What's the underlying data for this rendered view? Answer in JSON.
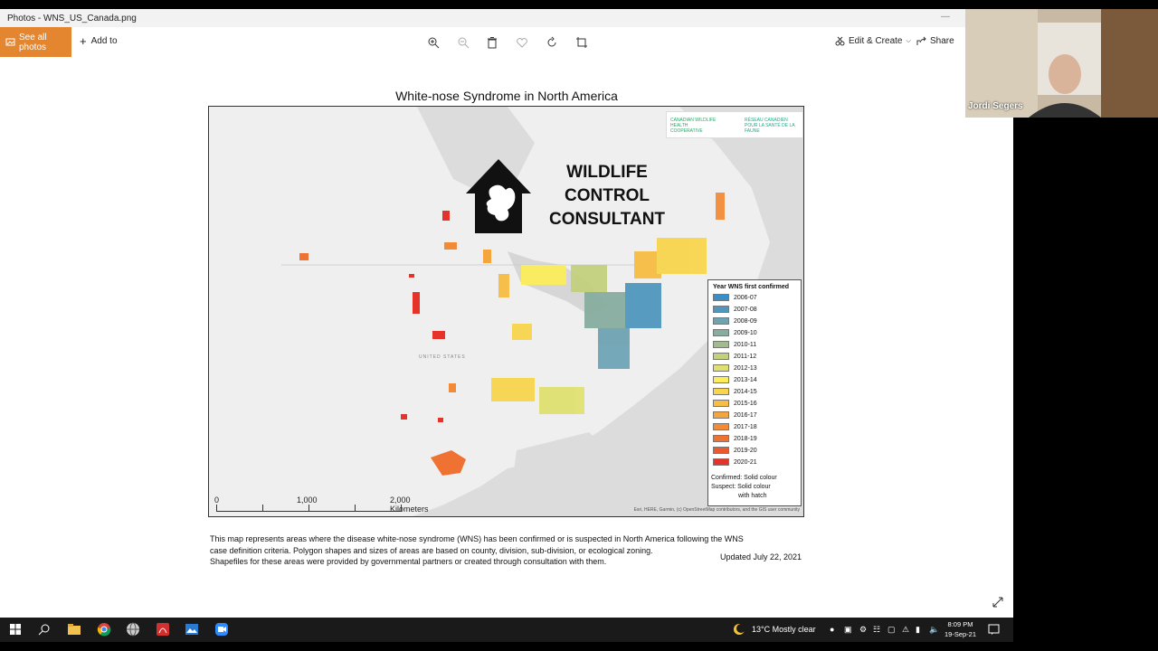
{
  "window": {
    "title": "Photos - WNS_US_Canada.png"
  },
  "toolbar": {
    "see_all_label": "See all photos",
    "add_to_label": "Add to",
    "edit_label": "Edit & Create",
    "share_label": "Share"
  },
  "map": {
    "title": "White-nose Syndrome in North America",
    "watermark": "WILDLIFE CONTROL CONSULTANT",
    "partner_logo_left": "CANADIAN WILDLIFE HEALTH COOPERATIVE",
    "partner_logo_right": "RÉSEAU CANADIEN POUR LA SANTÉ DE LA FAUNE",
    "country_label": "UNITED STATES",
    "scale": {
      "zero": "0",
      "mid": "1,000",
      "end": "2,000 Kilometers"
    },
    "attribution": "Esri, HERE, Garmin, (c) OpenStreetMap contributors, and the GIS user community",
    "legend": {
      "title": "Year WNS first confirmed",
      "items": [
        {
          "label": "2006-07",
          "color": "#3a8fc8"
        },
        {
          "label": "2007-08",
          "color": "#4f97bf"
        },
        {
          "label": "2008-09",
          "color": "#6ea3b4"
        },
        {
          "label": "2009-10",
          "color": "#87ad9f"
        },
        {
          "label": "2010-11",
          "color": "#a2bb8e"
        },
        {
          "label": "2011-12",
          "color": "#c3d07e"
        },
        {
          "label": "2012-13",
          "color": "#dfe070"
        },
        {
          "label": "2013-14",
          "color": "#fbee5a"
        },
        {
          "label": "2014-15",
          "color": "#f9d54d"
        },
        {
          "label": "2015-16",
          "color": "#f7bd44"
        },
        {
          "label": "2016-17",
          "color": "#f4a53d"
        },
        {
          "label": "2017-18",
          "color": "#f28b38"
        },
        {
          "label": "2018-19",
          "color": "#ef7232"
        },
        {
          "label": "2019-20",
          "color": "#eb5a2e"
        },
        {
          "label": "2020-21",
          "color": "#e63329"
        }
      ],
      "footnote_1": "Confirmed: Solid colour",
      "footnote_2": "Suspect: Solid colour",
      "footnote_3": "with hatch"
    }
  },
  "caption": {
    "line1": "This map represents areas where the disease white-nose syndrome (WNS) has been confirmed or is suspected in North America following the WNS",
    "line2": "case definition criteria. Polygon shapes and sizes of areas are based on county, division, sub-division, or ecological zoning.",
    "line3": "Shapefiles for these areas were provided by governmental partners or created through consultation with them.",
    "updated": "Updated July 22, 2021"
  },
  "webcam": {
    "name": "Jordi Segers"
  },
  "taskbar": {
    "weather": "13°C  Mostly clear",
    "time": "8:09 PM",
    "date": "19-Sep-21"
  }
}
